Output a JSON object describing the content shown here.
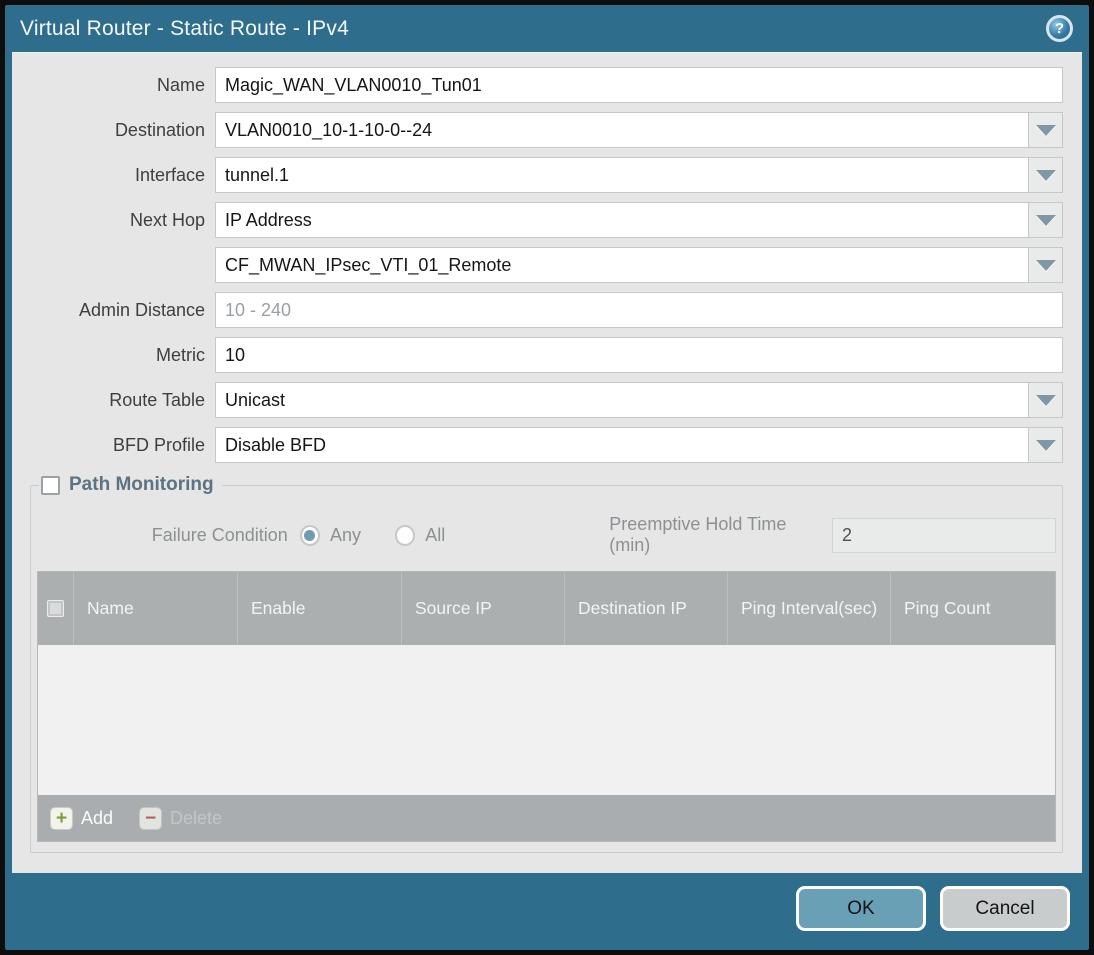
{
  "window": {
    "title": "Virtual Router - Static Route - IPv4",
    "help_icon_glyph": "?"
  },
  "form": {
    "name": {
      "label": "Name",
      "value": "Magic_WAN_VLAN0010_Tun01"
    },
    "destination": {
      "label": "Destination",
      "value": "VLAN0010_10-1-10-0--24"
    },
    "interface": {
      "label": "Interface",
      "value": "tunnel.1"
    },
    "next_hop": {
      "label": "Next Hop",
      "value": "IP Address"
    },
    "next_hop_address": {
      "value": "CF_MWAN_IPsec_VTI_01_Remote"
    },
    "admin_distance": {
      "label": "Admin Distance",
      "value": "",
      "placeholder": "10 - 240"
    },
    "metric": {
      "label": "Metric",
      "value": "10"
    },
    "route_table": {
      "label": "Route Table",
      "value": "Unicast"
    },
    "bfd_profile": {
      "label": "BFD Profile",
      "value": "Disable BFD"
    }
  },
  "path_monitoring": {
    "title": "Path Monitoring",
    "checkbox_checked": false,
    "failure_condition": {
      "label": "Failure Condition",
      "options": [
        "Any",
        "All"
      ],
      "selected": "Any"
    },
    "preemptive_hold_time": {
      "label": "Preemptive Hold Time (min)",
      "value": "2"
    },
    "table": {
      "columns": [
        "Name",
        "Enable",
        "Source IP",
        "Destination IP",
        "Ping Interval(sec)",
        "Ping Count"
      ],
      "rows": []
    },
    "toolbar": {
      "add_label": "Add",
      "delete_label": "Delete",
      "add_icon_glyph": "+",
      "delete_icon_glyph": "−",
      "delete_enabled": false
    }
  },
  "footer": {
    "ok_label": "OK",
    "cancel_label": "Cancel"
  },
  "colors": {
    "frame_teal": "#2e6d8c",
    "content_bg": "#e5e6e5",
    "table_header_bg": "#abafb0",
    "toolbar_bg": "#a9adaf",
    "ok_button_bg": "#6aa0b6",
    "cancel_button_bg": "#c9cccd",
    "add_icon_green": "#7c9c3c",
    "delete_icon_red": "#a8655c",
    "radio_selected_fill": "#6f9cb0"
  }
}
